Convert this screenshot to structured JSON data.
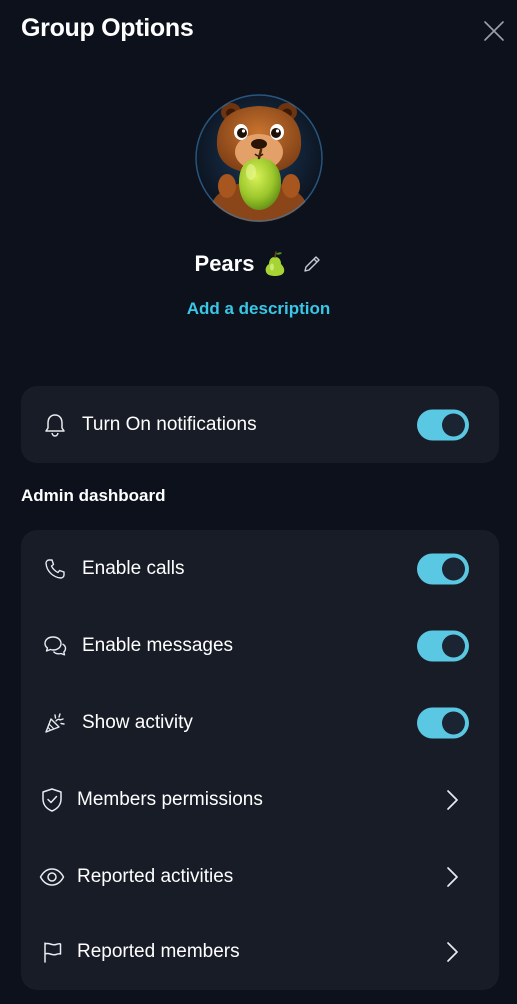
{
  "header": {
    "title": "Group Options",
    "close_icon": "close-icon"
  },
  "group": {
    "name": "Pears",
    "name_emoji": "pear",
    "avatar": "capybara-eating-pear",
    "add_description": "Add a description"
  },
  "notifications": {
    "label": "Turn On notifications",
    "icon": "bell-icon",
    "enabled": true
  },
  "admin": {
    "title": "Admin dashboard",
    "items": [
      {
        "label": "Enable calls",
        "icon": "phone-icon",
        "control": "toggle",
        "enabled": true
      },
      {
        "label": "Enable messages",
        "icon": "chat-bubbles-icon",
        "control": "toggle",
        "enabled": true
      },
      {
        "label": "Show activity",
        "icon": "party-popper-icon",
        "control": "toggle",
        "enabled": true
      },
      {
        "label": "Members permissions",
        "icon": "shield-check-icon",
        "control": "chevron"
      },
      {
        "label": "Reported activities",
        "icon": "eye-icon",
        "control": "chevron"
      },
      {
        "label": "Reported members",
        "icon": "flag-icon",
        "control": "chevron"
      }
    ]
  },
  "colors": {
    "background": "#0c111b",
    "card": "#181c27",
    "accent": "#3ac6e6",
    "toggle_on": "#5bc8e3",
    "toggle_knob": "#1b2432"
  }
}
